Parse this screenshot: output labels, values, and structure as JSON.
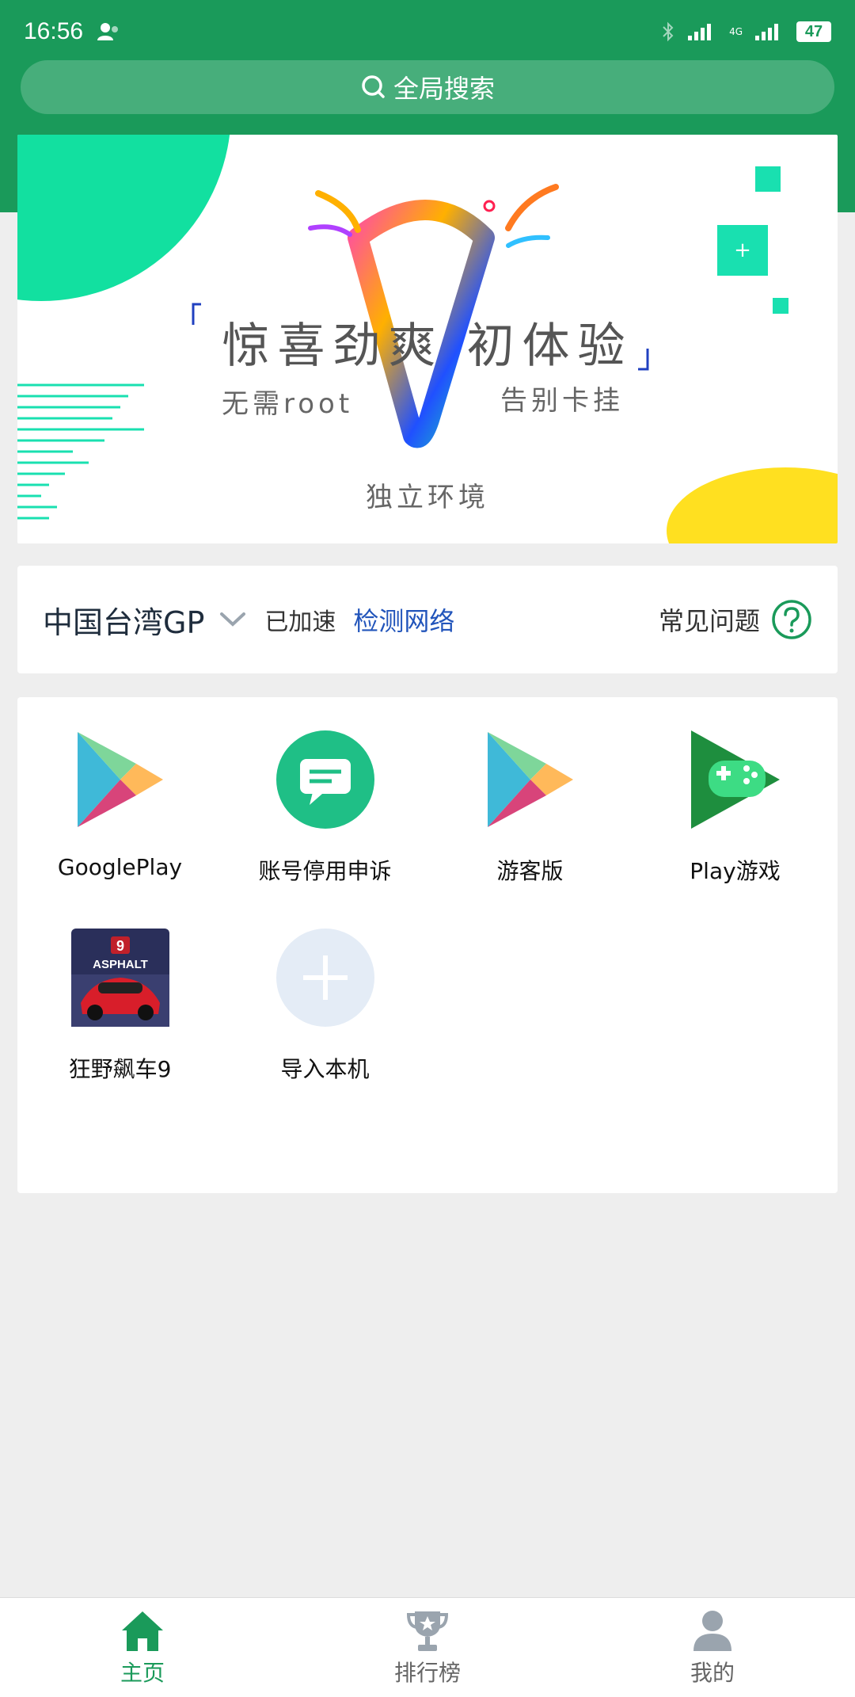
{
  "status_bar": {
    "time": "16:56",
    "network": "4G",
    "battery": "47"
  },
  "search": {
    "label": "全局搜索"
  },
  "banner": {
    "title": "惊喜劲爽  初体验",
    "sub_left": "无需root",
    "sub_right": "告别卡挂",
    "sub_bottom": "独立环境"
  },
  "region": {
    "name": "中国台湾GP",
    "status": "已加速",
    "detect_link": "检测网络",
    "faq": "常见问题"
  },
  "apps": [
    {
      "label": "GooglePlay",
      "icon": "google-play-icon"
    },
    {
      "label": "账号停用申诉",
      "icon": "chat-bubble-icon"
    },
    {
      "label": "游客版",
      "icon": "google-play-icon"
    },
    {
      "label": "Play游戏",
      "icon": "play-games-icon"
    },
    {
      "label": "狂野飙车9",
      "icon": "asphalt-9-icon",
      "icon_text": "ASPHALT"
    },
    {
      "label": "导入本机",
      "icon": "plus-icon"
    }
  ],
  "nav": [
    {
      "label": "主页",
      "icon": "home-icon",
      "active": true
    },
    {
      "label": "排行榜",
      "icon": "trophy-icon",
      "active": false
    },
    {
      "label": "我的",
      "icon": "person-icon",
      "active": false
    }
  ],
  "colors": {
    "brand": "#1a9a5a",
    "link": "#2255bb",
    "accent": "#1ad9a0"
  }
}
